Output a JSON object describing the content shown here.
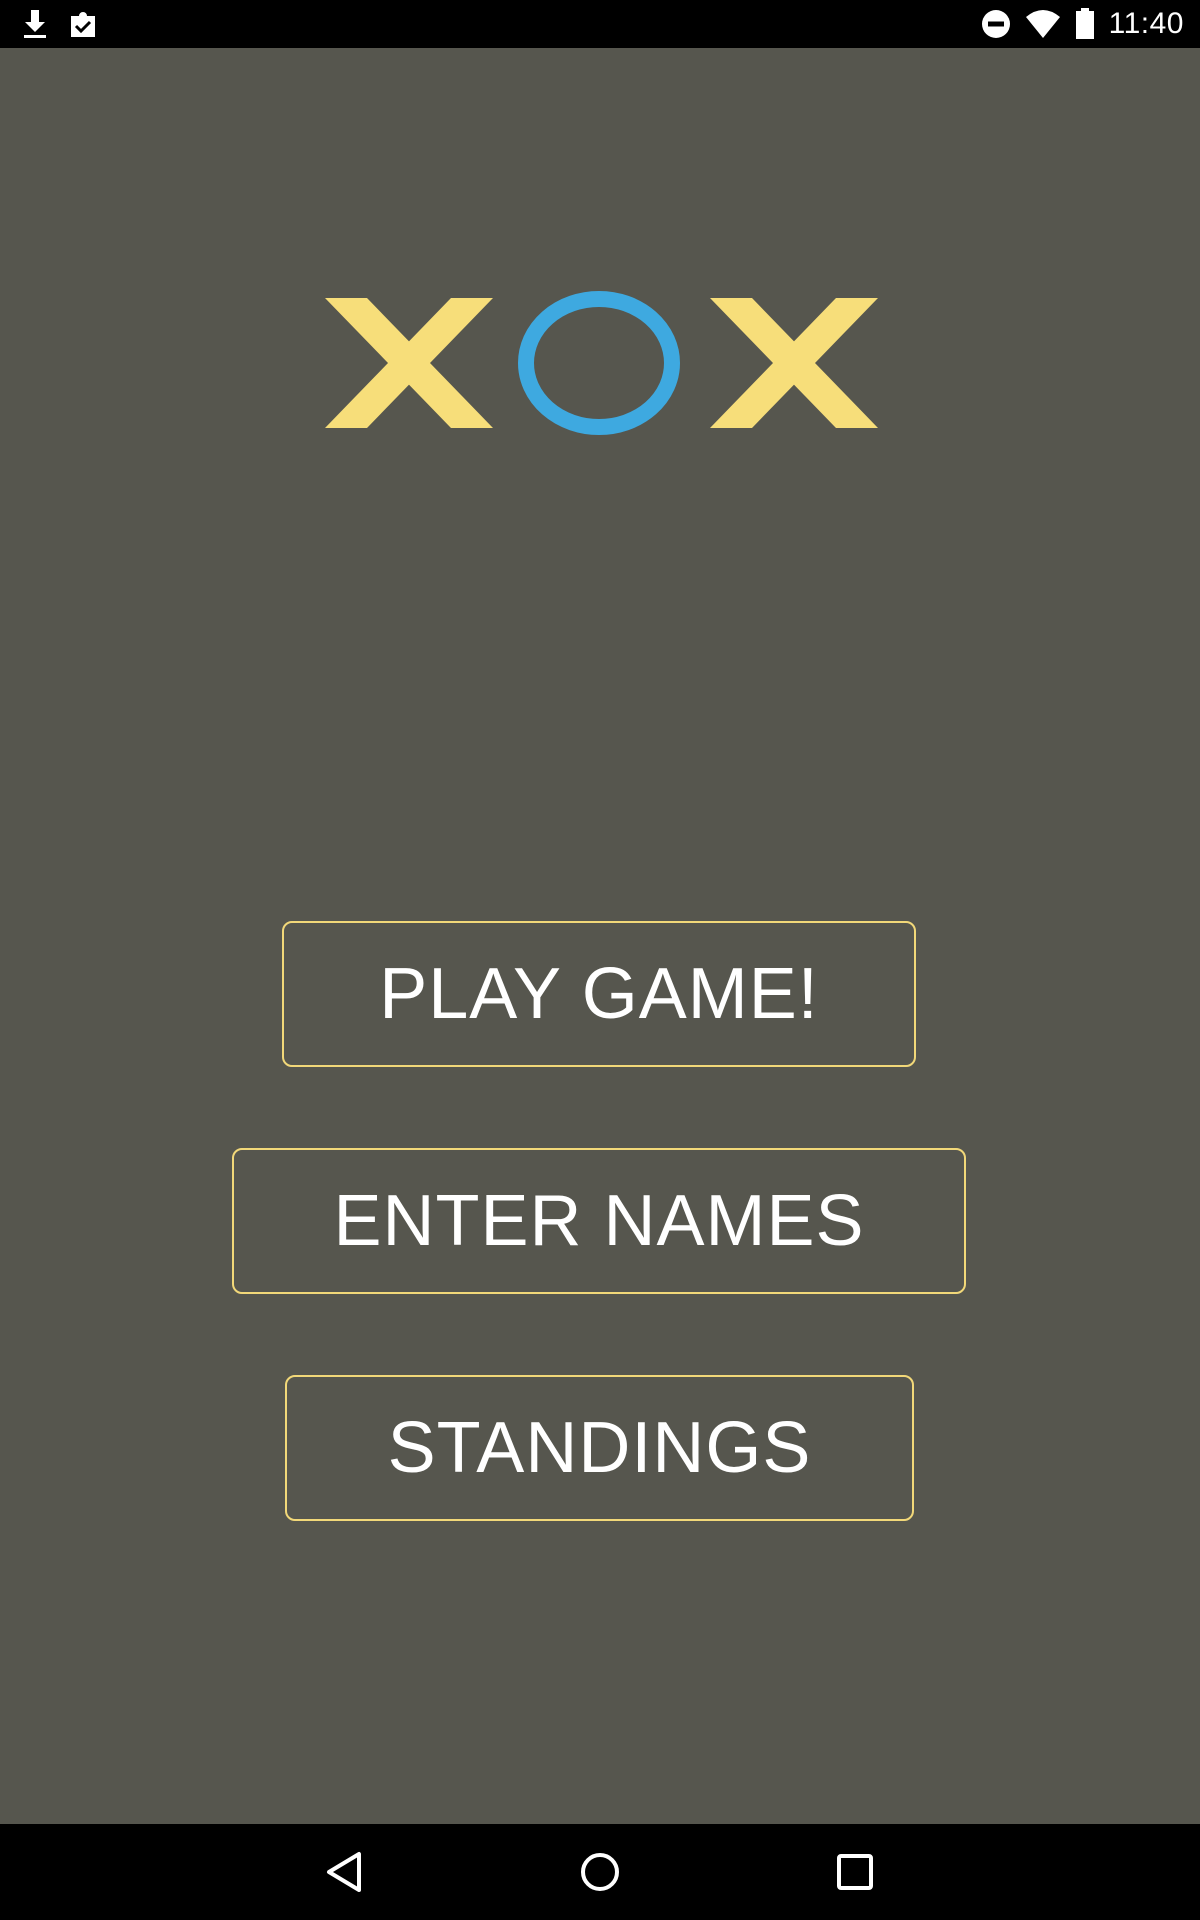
{
  "status_bar": {
    "time": "11:40",
    "left_icons": [
      "download-icon",
      "clipboard-check-icon"
    ],
    "right_icons": [
      "do-not-disturb-icon",
      "wifi-icon",
      "battery-icon"
    ]
  },
  "logo": {
    "text": "XOX",
    "letter_colors": {
      "x": "#f7de7a",
      "o": "#3ea9e0"
    }
  },
  "menu": {
    "play_label": "PLAY GAME!",
    "names_label": "ENTER NAMES",
    "standings_label": "STANDINGS"
  },
  "colors": {
    "background": "#56564e",
    "button_border": "#f2d879",
    "button_text": "#ffffff",
    "bars": "#000000"
  },
  "nav_bar": {
    "icons": [
      "back-icon",
      "home-icon",
      "recents-icon"
    ]
  }
}
